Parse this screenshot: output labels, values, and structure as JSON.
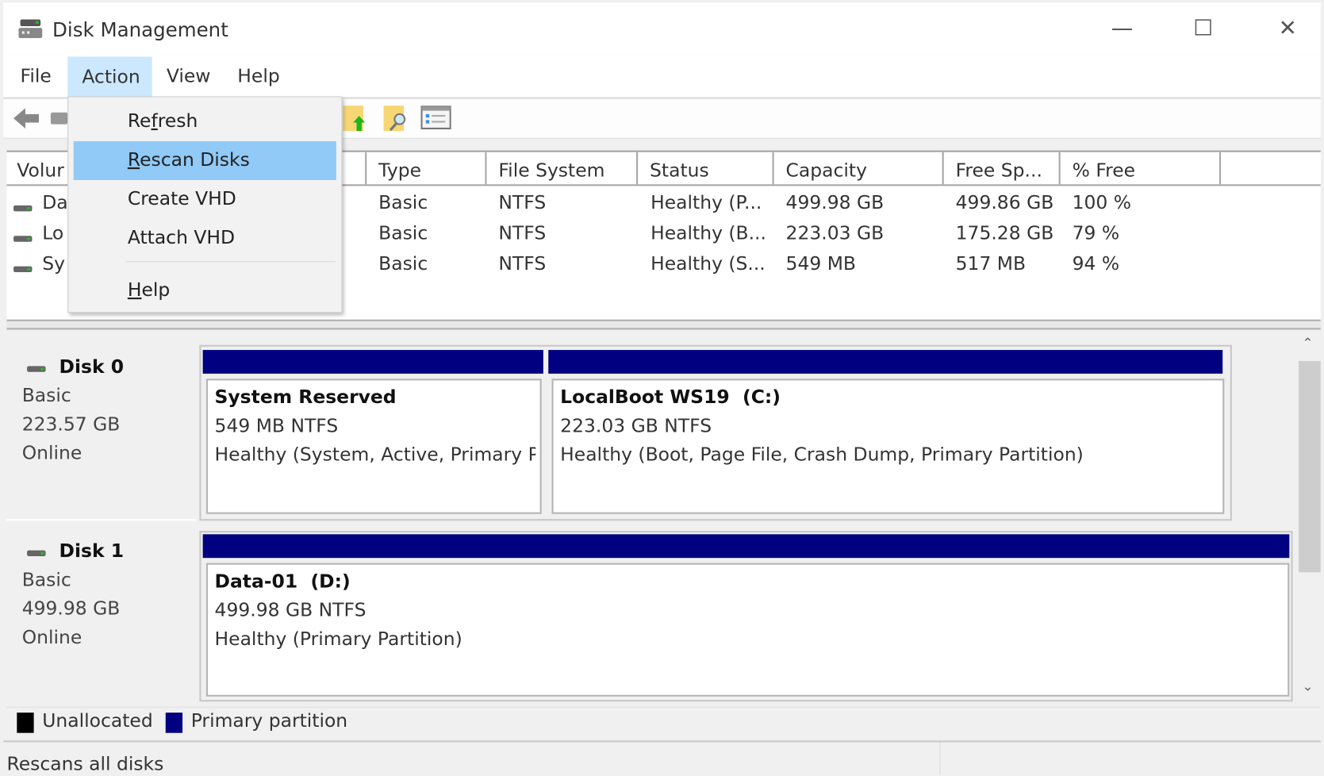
{
  "window": {
    "title": "Disk Management",
    "controls": {
      "minimize": "—",
      "maximize": "☐",
      "close": "✕"
    }
  },
  "menubar": {
    "items": [
      "File",
      "Action",
      "View",
      "Help"
    ],
    "active": "Action"
  },
  "action_menu": {
    "items": [
      {
        "label": "Refresh",
        "mnemonic": "f"
      },
      {
        "label": "Rescan Disks",
        "mnemonic": "R",
        "highlighted": true
      },
      {
        "label": "Create VHD"
      },
      {
        "label": "Attach VHD"
      },
      {
        "label": "Help",
        "mnemonic": "H"
      }
    ]
  },
  "toolbar": {
    "icons": [
      "back-arrow-icon",
      "forward-icon",
      "folder-up-icon",
      "folder-search-icon",
      "properties-list-icon"
    ]
  },
  "volume_list": {
    "columns": [
      "Volur",
      "Type",
      "File System",
      "Status",
      "Capacity",
      "Free Sp...",
      "% Free"
    ],
    "rows": [
      {
        "volume": "Da",
        "type": "Basic",
        "fs": "NTFS",
        "status": "Healthy (P...",
        "capacity": "499.98 GB",
        "free": "499.86 GB",
        "pct": "100 %"
      },
      {
        "volume": "Lo",
        "type": "Basic",
        "fs": "NTFS",
        "status": "Healthy (B...",
        "capacity": "223.03 GB",
        "free": "175.28 GB",
        "pct": "79 %"
      },
      {
        "volume": "Sy",
        "type": "Basic",
        "fs": "NTFS",
        "status": "Healthy (S...",
        "capacity": "549 MB",
        "free": "517 MB",
        "pct": "94 %"
      }
    ]
  },
  "disks": [
    {
      "name": "Disk 0",
      "type": "Basic",
      "size": "223.57 GB",
      "state": "Online",
      "partitions": [
        {
          "title": "System Reserved",
          "size": "549 MB NTFS",
          "status": "Healthy (System, Active, Primary P"
        },
        {
          "title": "LocalBoot WS19  (C:)",
          "size": "223.03 GB NTFS",
          "status": "Healthy (Boot, Page File, Crash Dump, Primary Partition)"
        }
      ]
    },
    {
      "name": "Disk 1",
      "type": "Basic",
      "size": "499.98 GB",
      "state": "Online",
      "partitions": [
        {
          "title": "Data-01  (D:)",
          "size": "499.98 GB NTFS",
          "status": "Healthy (Primary Partition)"
        }
      ]
    }
  ],
  "legend": [
    {
      "label": "Unallocated",
      "color": "#000000"
    },
    {
      "label": "Primary partition",
      "color": "#000080"
    }
  ],
  "status_bar": {
    "text": "Rescans all disks"
  },
  "colors": {
    "primary_partition": "#000080",
    "menu_highlight": "#91c9f7",
    "menu_active": "#cce8ff"
  }
}
